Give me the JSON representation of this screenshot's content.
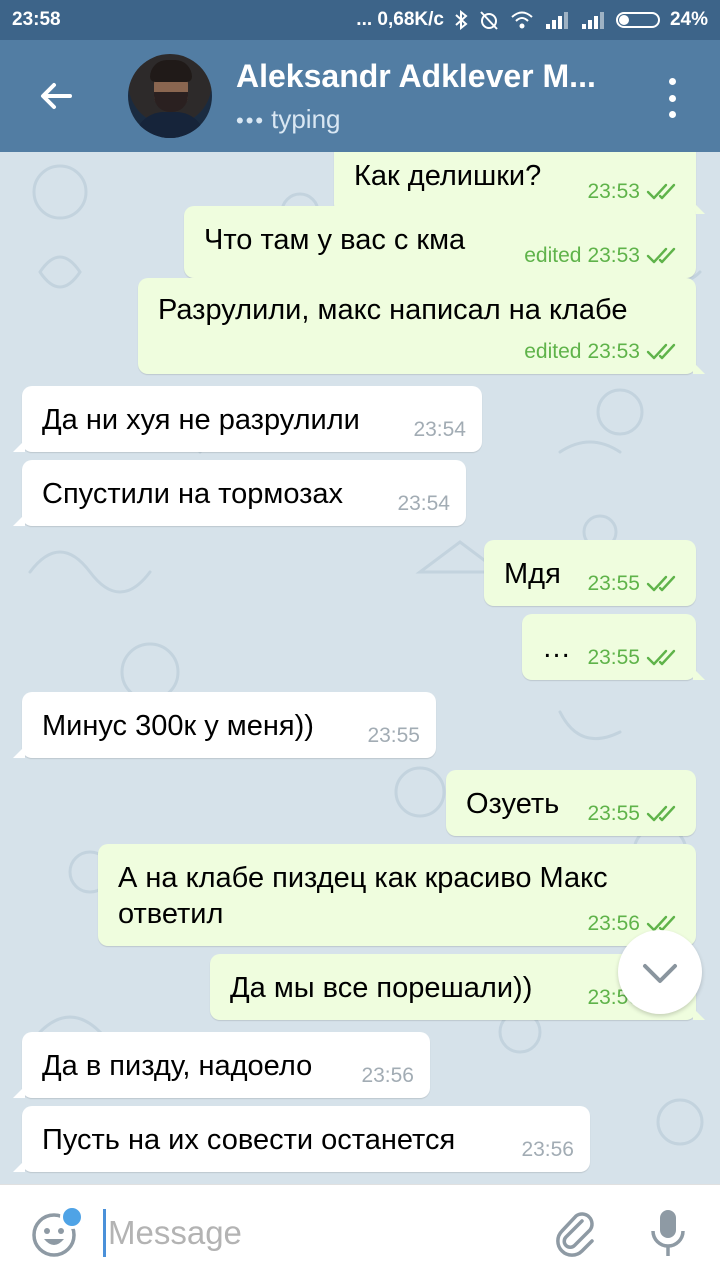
{
  "status_bar": {
    "time": "23:58",
    "network_speed": "... 0,68K/c",
    "battery": "24%",
    "battery_level": 0.24
  },
  "header": {
    "contact_name": "Aleksandr Adklever M...",
    "status": "typing",
    "status_dots": "•••",
    "icons": {
      "back": "arrow-left-icon",
      "menu": "kebab-menu-icon"
    }
  },
  "messages": [
    {
      "dir": "out",
      "text": "Как делишки?",
      "time": "23:53",
      "edited": ""
    },
    {
      "dir": "out",
      "text": "Что там у вас с кма",
      "time": "23:53",
      "edited": "edited"
    },
    {
      "dir": "out",
      "text": "Разрулили, макс написал на клабе",
      "time": "23:53",
      "edited": "edited"
    },
    {
      "dir": "in",
      "text": "Да ни хуя не разрулили",
      "time": "23:54",
      "edited": ""
    },
    {
      "dir": "in",
      "text": "Спустили на тормозах",
      "time": "23:54",
      "edited": ""
    },
    {
      "dir": "out",
      "text": "Мдя",
      "time": "23:55",
      "edited": ""
    },
    {
      "dir": "out",
      "text": "…",
      "time": "23:55",
      "edited": ""
    },
    {
      "dir": "in",
      "text": "Минус 300к у меня))",
      "time": "23:55",
      "edited": ""
    },
    {
      "dir": "out",
      "text": "Озуеть",
      "time": "23:55",
      "edited": ""
    },
    {
      "dir": "out",
      "text": "А на клабе пиздец как красиво Макс",
      "text2": "ответил",
      "time": "23:56",
      "edited": ""
    },
    {
      "dir": "out",
      "text": "Да мы все порешали))",
      "time": "23:56",
      "edited": ""
    },
    {
      "dir": "in",
      "text": "Да в пизду, надоело",
      "time": "23:56",
      "edited": ""
    },
    {
      "dir": "in",
      "text": "Пусть на их совести останется",
      "time": "23:56",
      "edited": ""
    }
  ],
  "composer": {
    "placeholder": "Message",
    "value": "",
    "icons": {
      "emoji": "emoji-icon",
      "attach": "paperclip-icon",
      "mic": "microphone-icon",
      "scroll": "chevron-down-icon"
    }
  },
  "colors": {
    "status_bar": "#3d6489",
    "app_bar": "#527da3",
    "outgoing_bubble": "#effdde",
    "incoming_bubble": "#ffffff",
    "read_ticks": "#5fb34a",
    "chat_background": "#d6e2ea"
  }
}
